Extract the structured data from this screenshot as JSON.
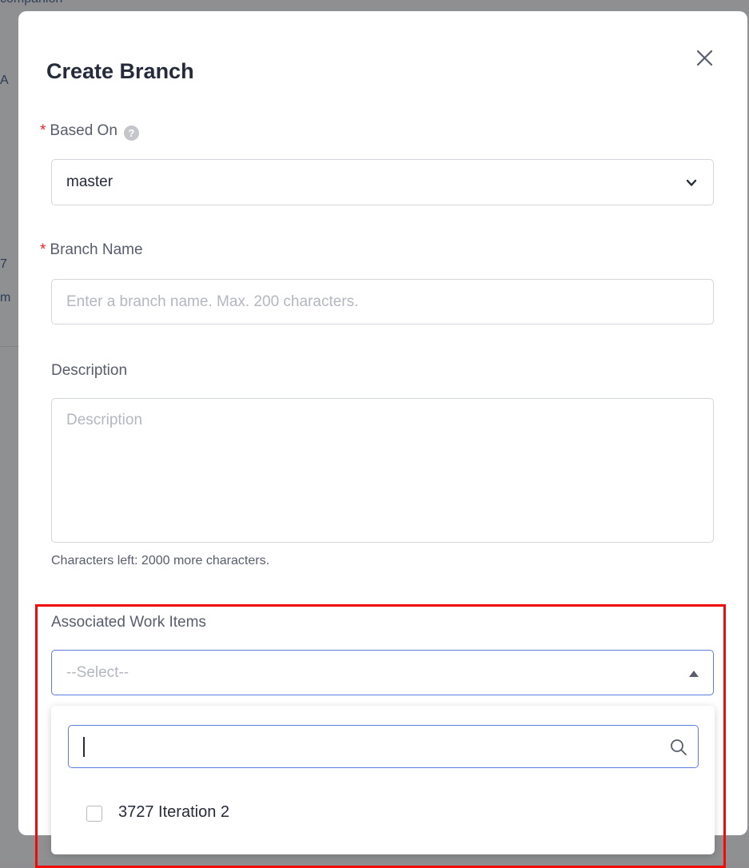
{
  "background": {
    "top_text": "companion",
    "edge_fragments": [
      "A",
      "7",
      "m"
    ]
  },
  "dialog": {
    "title": "Create Branch",
    "close_icon": "close-icon"
  },
  "form": {
    "based_on": {
      "label": "Based On",
      "required": true,
      "help_icon": "question-icon",
      "help_glyph": "?",
      "value": "master"
    },
    "branch_name": {
      "label": "Branch Name",
      "required": true,
      "placeholder": "Enter a branch name. Max. 200 characters.",
      "value": ""
    },
    "description": {
      "label": "Description",
      "placeholder": "Description",
      "value": "",
      "hint": "Characters left: 2000 more characters."
    },
    "associated_work_items": {
      "label": "Associated Work Items",
      "placeholder": "--Select--",
      "dropdown_open": true,
      "search_value": "",
      "options": [
        {
          "label": "3727 Iteration 2",
          "checked": false
        }
      ]
    }
  },
  "colors": {
    "required_star": "#f5222d",
    "focus_border": "#5e7ce0",
    "highlight_box": "#f10a0a",
    "overlay": "#8f9092"
  }
}
